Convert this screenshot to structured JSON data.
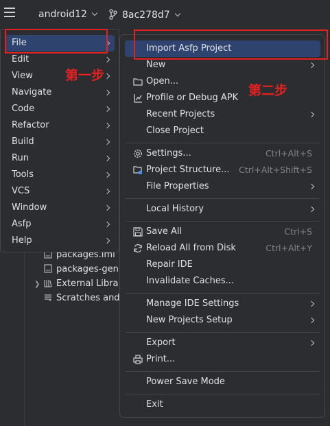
{
  "header": {
    "project": "android12",
    "branch": "8ac278d7"
  },
  "project_tree": [
    {
      "label": "packages.iml"
    },
    {
      "label": "packages-gen"
    },
    {
      "label": "External Libra"
    },
    {
      "label": "Scratches and"
    }
  ],
  "main_menu": {
    "items": [
      {
        "label": "File"
      },
      {
        "label": "Edit"
      },
      {
        "label": "View"
      },
      {
        "label": "Navigate"
      },
      {
        "label": "Code"
      },
      {
        "label": "Refactor"
      },
      {
        "label": "Build"
      },
      {
        "label": "Run"
      },
      {
        "label": "Tools"
      },
      {
        "label": "VCS"
      },
      {
        "label": "Window"
      },
      {
        "label": "Asfp"
      },
      {
        "label": "Help"
      }
    ]
  },
  "file_menu": {
    "items": [
      {
        "label": "Import Asfp Project"
      },
      {
        "label": "New"
      },
      {
        "label": "Open...",
        "icon": "folder-icon"
      },
      {
        "label": "Profile or Debug APK",
        "icon": "profile-icon"
      },
      {
        "label": "Recent Projects"
      },
      {
        "label": "Close Project"
      },
      {
        "label": "Settings...",
        "shortcut": "Ctrl+Alt+S",
        "icon": "gear-icon"
      },
      {
        "label": "Project Structure...",
        "shortcut": "Ctrl+Alt+Shift+S",
        "icon": "project-structure-icon"
      },
      {
        "label": "File Properties"
      },
      {
        "label": "Local History"
      },
      {
        "label": "Save All",
        "shortcut": "Ctrl+S",
        "icon": "save-icon"
      },
      {
        "label": "Reload All from Disk",
        "shortcut": "Ctrl+Alt+Y",
        "icon": "reload-icon"
      },
      {
        "label": "Repair IDE"
      },
      {
        "label": "Invalidate Caches..."
      },
      {
        "label": "Manage IDE Settings"
      },
      {
        "label": "New Projects Setup"
      },
      {
        "label": "Export"
      },
      {
        "label": "Print...",
        "icon": "print-icon"
      },
      {
        "label": "Power Save Mode"
      },
      {
        "label": "Exit"
      }
    ]
  },
  "annotations": {
    "step1": "第一步",
    "step2": "第二步"
  },
  "colors": {
    "background": "#2b2d30",
    "selection": "#2e436e",
    "annotation": "#e32121",
    "shortcut": "#7f8389"
  }
}
